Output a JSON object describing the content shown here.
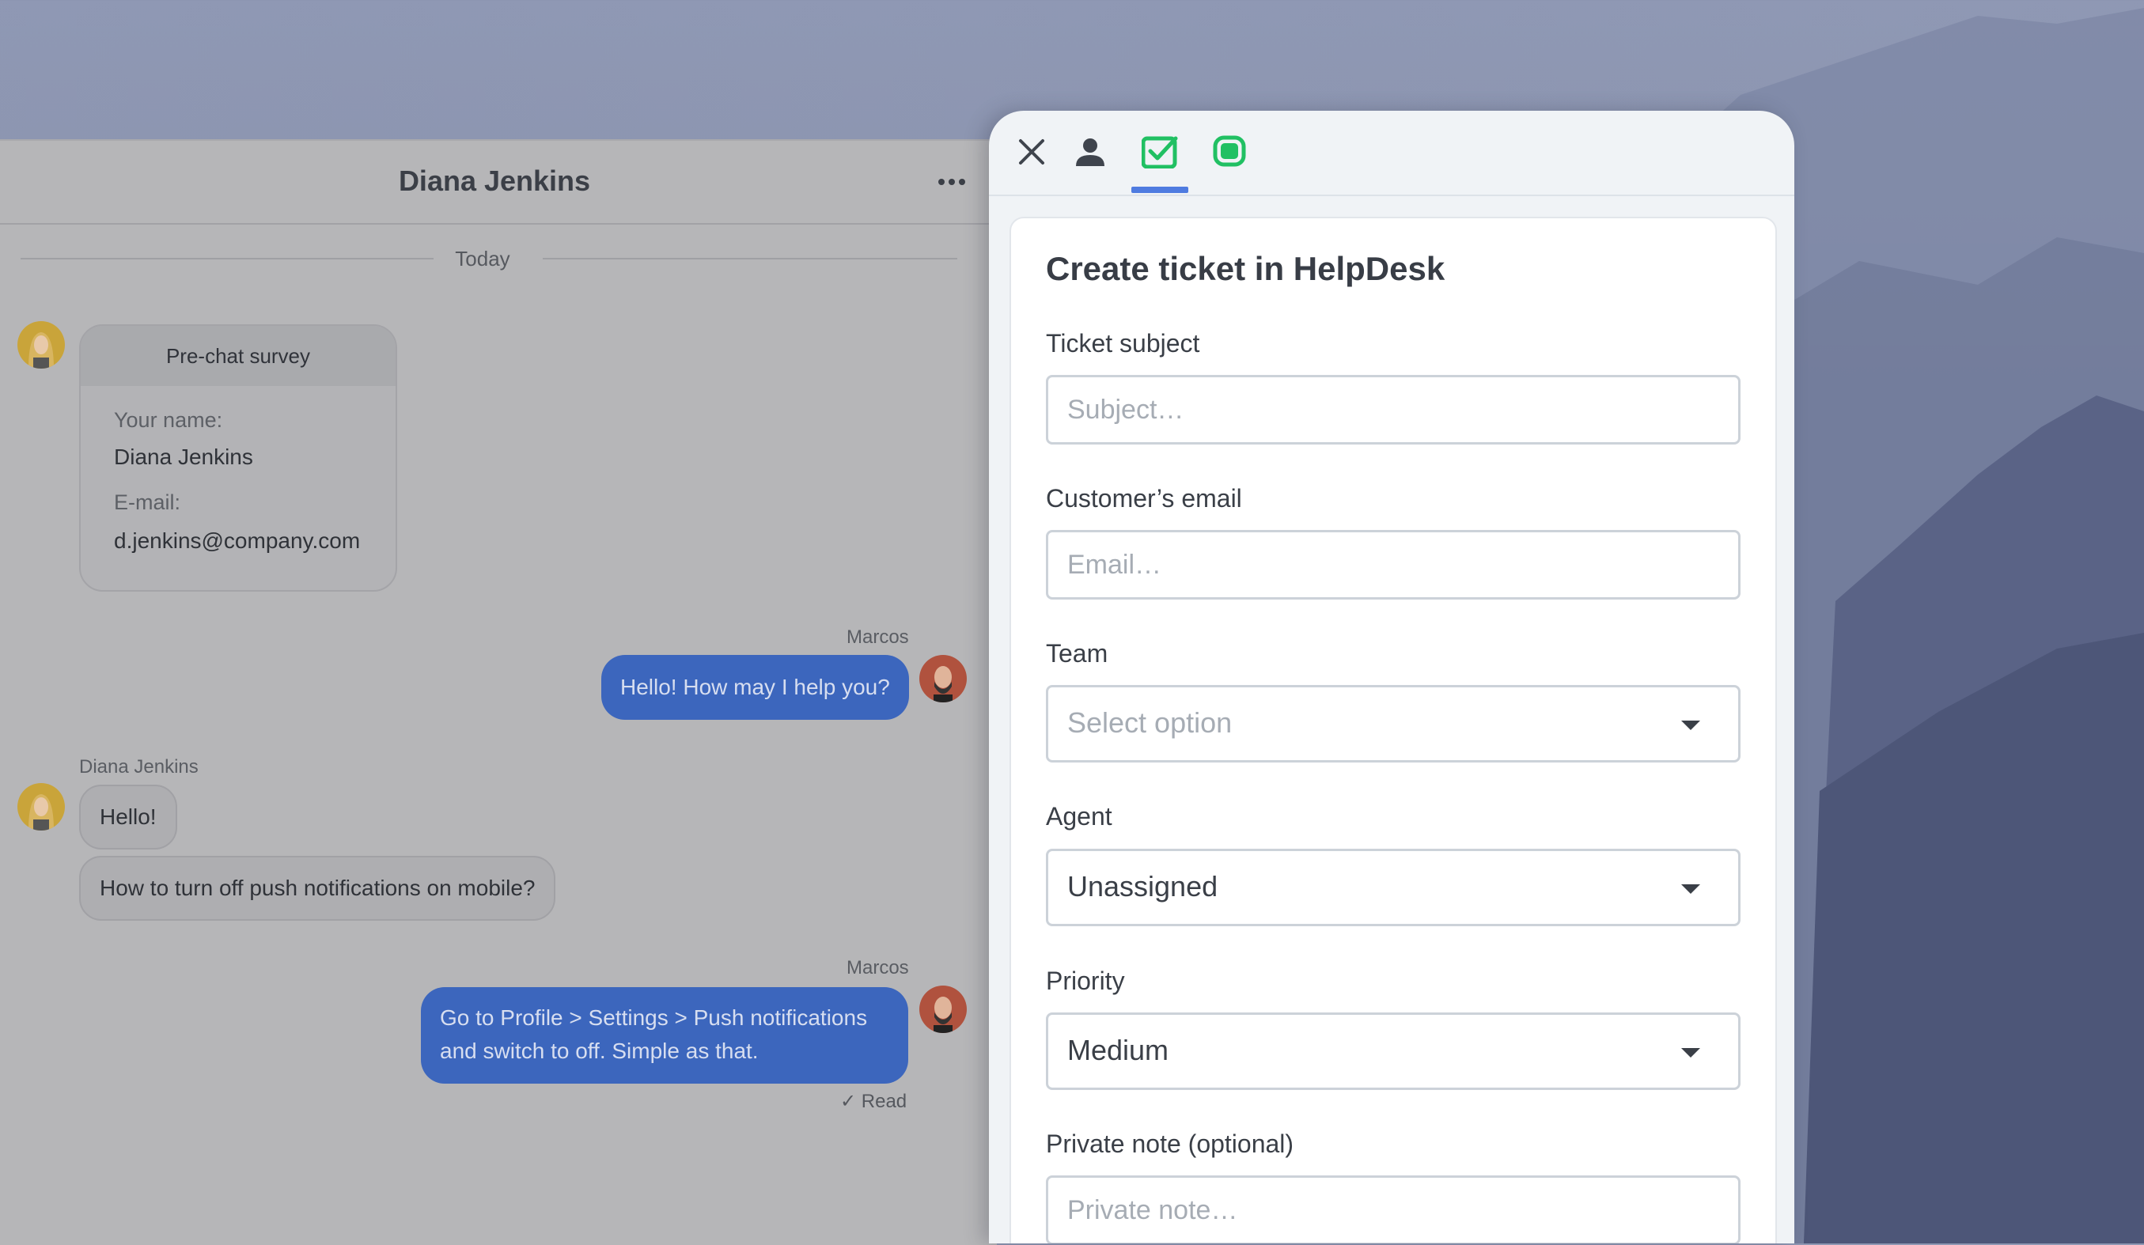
{
  "chat": {
    "title": "Diana Jenkins",
    "date_divider": "Today",
    "survey": {
      "title": "Pre-chat survey",
      "name_label": "Your name:",
      "name_value": "Diana Jenkins",
      "email_label": "E-mail:",
      "email_value": "d.jenkins@company.com"
    },
    "messages": [
      {
        "sender": "Marcos",
        "text": "Hello! How may I help you?"
      },
      {
        "sender": "Diana Jenkins",
        "text": "Hello!"
      },
      {
        "text": "How to turn off push notifications on mobile?"
      },
      {
        "sender": "Marcos",
        "line1": "Go to Profile > Settings > Push notifications",
        "line2": "and switch to off. Simple as that."
      }
    ],
    "read_status": "Read"
  },
  "panel": {
    "toolbar": {
      "icons": [
        "close-icon",
        "person-icon",
        "ticket-check-icon",
        "chat-bubble-icon"
      ],
      "active_color": "#21c063",
      "indicator_color": "#4f7be0"
    },
    "form": {
      "title": "Create ticket in HelpDesk",
      "subject_label": "Ticket subject",
      "subject_placeholder": "Subject…",
      "email_label": "Customer’s email",
      "email_placeholder": "Email…",
      "team_label": "Team",
      "team_value": "Select option",
      "agent_label": "Agent",
      "agent_value": "Unassigned",
      "priority_label": "Priority",
      "priority_value": "Medium",
      "note_label": "Private note (optional)",
      "note_placeholder": "Private note…"
    }
  }
}
